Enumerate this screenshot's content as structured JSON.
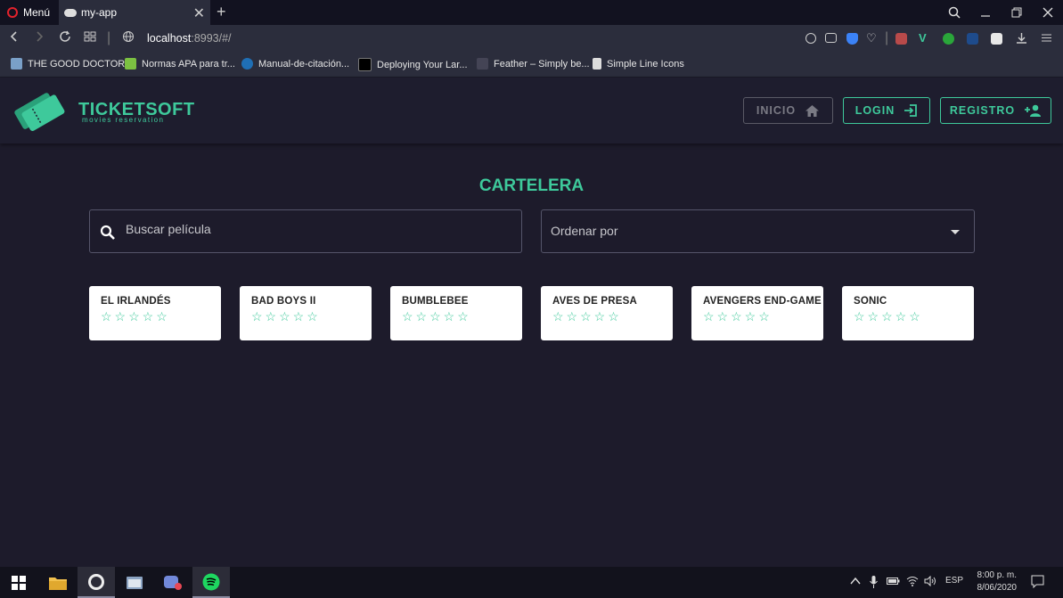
{
  "browser": {
    "menu_label": "Menú",
    "tab_title": "my-app",
    "tab_close": "✕",
    "new_tab": "+",
    "url_host": "localhost",
    "url_rest": ":8993/#/",
    "bookmarks": [
      {
        "label": "THE GOOD DOCTOR",
        "color": "#7aa0c8"
      },
      {
        "label": "Normas APA para tr...",
        "color": "#7cc142"
      },
      {
        "label": "Manual-de-citación...",
        "color": "#1f6fb5"
      },
      {
        "label": "Deploying Your Lar...",
        "color": "#000000"
      },
      {
        "label": "Feather – Simply be...",
        "color": "#444455"
      },
      {
        "label": "Simple Line Icons",
        "color": "#dddddd"
      }
    ]
  },
  "header": {
    "brand": "TICKETSOFT",
    "brand_sub": "movies reservation",
    "nav": {
      "inicio": "INICIO",
      "login": "LOGIN",
      "registro": "REGISTRO"
    }
  },
  "main": {
    "title": "CARTELERA",
    "search_placeholder": "Buscar película",
    "sort_label": "Ordenar por",
    "movies": [
      {
        "title": "EL IRLANDÉS",
        "stars": "☆☆☆☆☆"
      },
      {
        "title": "BAD BOYS II",
        "stars": "☆☆☆☆☆"
      },
      {
        "title": "BUMBLEBEE",
        "stars": "☆☆☆☆☆"
      },
      {
        "title": "AVES DE PRESA",
        "stars": "☆☆☆☆☆"
      },
      {
        "title": "AVENGERS END-GAME",
        "stars": "☆☆☆☆☆"
      },
      {
        "title": "SONIC",
        "stars": "☆☆☆☆☆"
      }
    ]
  },
  "taskbar": {
    "language": "ESP",
    "time": "8:00 p. m.",
    "date": "8/06/2020"
  },
  "colors": {
    "accent": "#3ec99b",
    "background": "#1d1b2b"
  }
}
